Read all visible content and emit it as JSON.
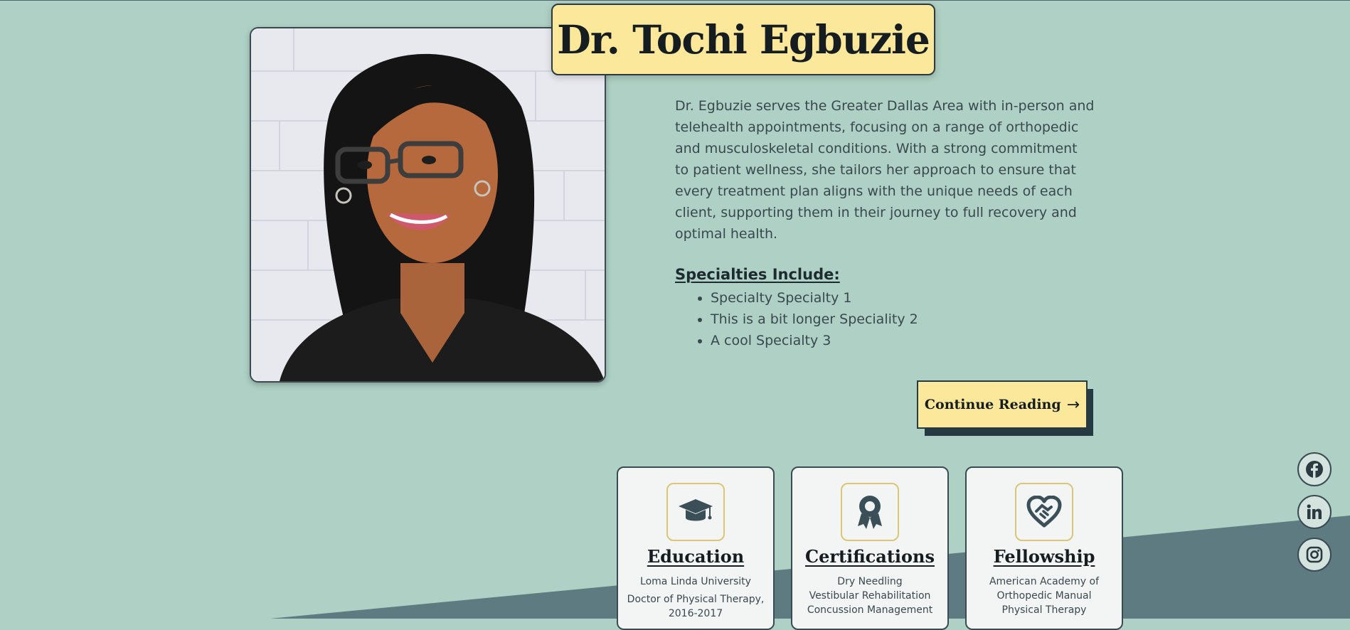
{
  "doctor": {
    "name": "Dr. Tochi Egbuzie",
    "bio": "Dr. Egbuzie serves the Greater Dallas Area with in-person and telehealth appointments, focusing on a range of orthopedic and musculoskeletal conditions. With a strong commitment to patient wellness, she tailors her approach to ensure that every treatment plan aligns with the unique needs of each client, supporting them in their journey to full recovery and optimal health."
  },
  "specialties": {
    "heading": "Specialties Include:",
    "items": [
      "Specialty Specialty 1",
      "This is a bit longer Speciality 2",
      "A cool Specialty 3"
    ]
  },
  "continue_button": {
    "label": "Continue Reading",
    "arrow": "→"
  },
  "cards": [
    {
      "title": "Education",
      "icon": "graduation-cap-icon",
      "lines": [
        "Loma Linda University",
        "Doctor of Physical Therapy, 2016-2017"
      ]
    },
    {
      "title": "Certifications",
      "icon": "award-ribbon-icon",
      "lines": [
        "Dry Needling",
        "Vestibular Rehabilitation",
        "Concussion Management"
      ]
    },
    {
      "title": "Fellowship",
      "icon": "heart-handshake-icon",
      "lines": [
        "American Academy of Orthopedic Manual Physical Therapy"
      ]
    }
  ],
  "social": [
    "facebook-icon",
    "linkedin-icon",
    "instagram-icon"
  ],
  "colors": {
    "background": "#afd0c4",
    "accent_yellow": "#fce89b",
    "dark_teal": "#253a42",
    "slant": "#5d7b80"
  }
}
